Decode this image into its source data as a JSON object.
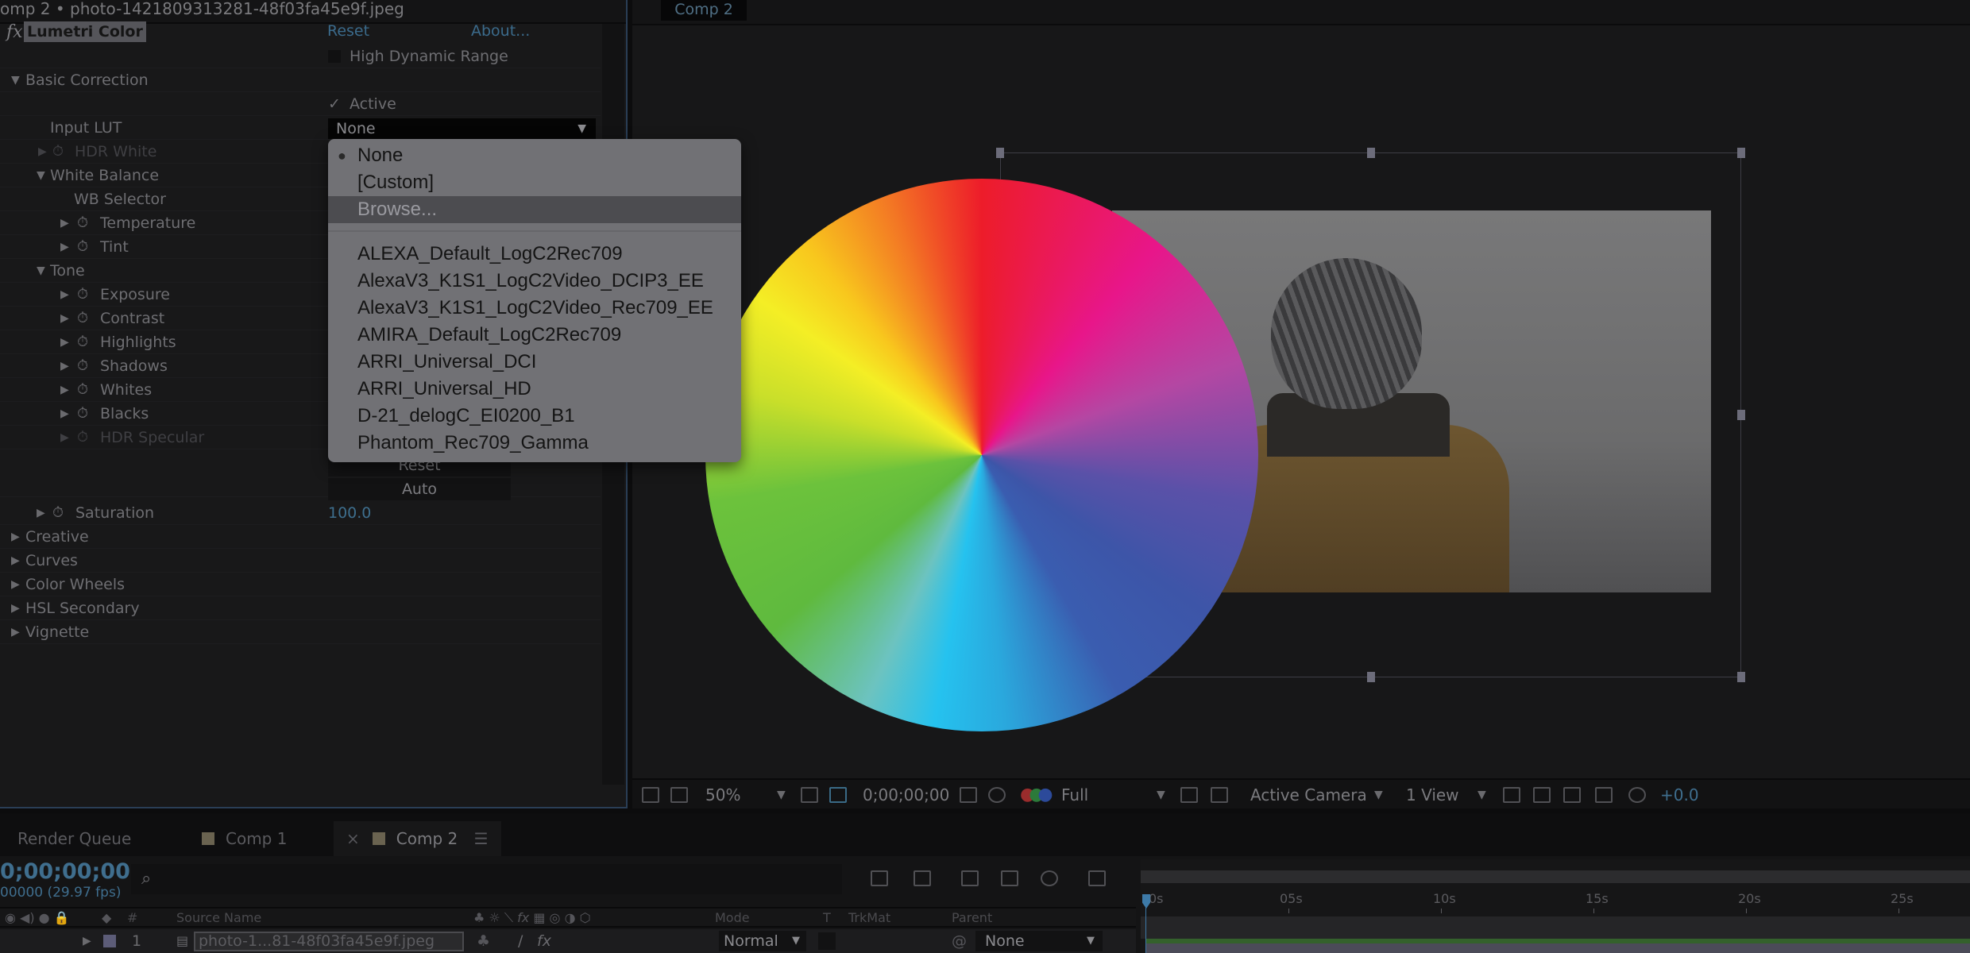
{
  "effect_controls": {
    "breadcrumb": "omp 2 • photo-1421809313281-48f03fa45e9f.jpeg",
    "effect_badge": "fx",
    "effect_name": "Lumetri Color",
    "reset_link": "Reset",
    "about_link": "About...",
    "hdr_label": "High Dynamic Range",
    "hdr_checked": false,
    "basic_correction": "Basic Correction",
    "active_label": "Active",
    "active_check": "✓",
    "input_lut_label": "Input LUT",
    "input_lut_value": "None",
    "hdr_white": "HDR White",
    "white_balance": "White Balance",
    "wb_selector": "WB Selector",
    "temperature": "Temperature",
    "tint": "Tint",
    "tone": "Tone",
    "exposure": "Exposure",
    "contrast": "Contrast",
    "highlights": "Highlights",
    "shadows": "Shadows",
    "whites": "Whites",
    "blacks": "Blacks",
    "hdr_specular": "HDR Specular",
    "tone_reset_button": "Reset",
    "tone_auto_button": "Auto",
    "saturation": "Saturation",
    "saturation_value": "100.0",
    "creative": "Creative",
    "curves": "Curves",
    "color_wheels": "Color Wheels",
    "hsl_secondary": "HSL Secondary",
    "vignette": "Vignette"
  },
  "lut_dropdown": {
    "selected": "None",
    "highlighted": "Browse...",
    "top_items": [
      "None",
      "[Custom]",
      "Browse..."
    ],
    "lut_items": [
      "ALEXA_Default_LogC2Rec709",
      "AlexaV3_K1S1_LogC2Video_DCIP3_EE",
      "AlexaV3_K1S1_LogC2Video_Rec709_EE",
      "AMIRA_Default_LogC2Rec709",
      "ARRI_Universal_DCI",
      "ARRI_Universal_HD",
      "D-21_delogC_EI0200_B1",
      "Phantom_Rec709_Gamma"
    ]
  },
  "viewer": {
    "tab": "Comp 2",
    "toolbar": {
      "zoom": "50%",
      "timecode": "0;00;00;00",
      "resolution": "Full",
      "camera": "Active Camera",
      "views": "1 View",
      "exposure": "+0.0"
    }
  },
  "timeline": {
    "tabs": [
      {
        "label": "Render Queue"
      },
      {
        "label": "Comp 1"
      },
      {
        "label": "Comp 2",
        "active": true
      }
    ],
    "close_glyph": "×",
    "menu_glyph": "☰",
    "timecode": "0;00;00;00",
    "frames": "00000 (29.97 fps)",
    "columns": {
      "hash": "#",
      "source_name": "Source Name",
      "mode": "Mode",
      "t": "T",
      "trkmat": "TrkMat",
      "parent": "Parent"
    },
    "layer": {
      "index": "1",
      "name": "photo-1...81-48f03fa45e9f.jpeg",
      "mode": "Normal",
      "parent": "None"
    },
    "ruler_ticks": [
      "0s",
      "05s",
      "10s",
      "15s",
      "20s",
      "25s"
    ]
  }
}
